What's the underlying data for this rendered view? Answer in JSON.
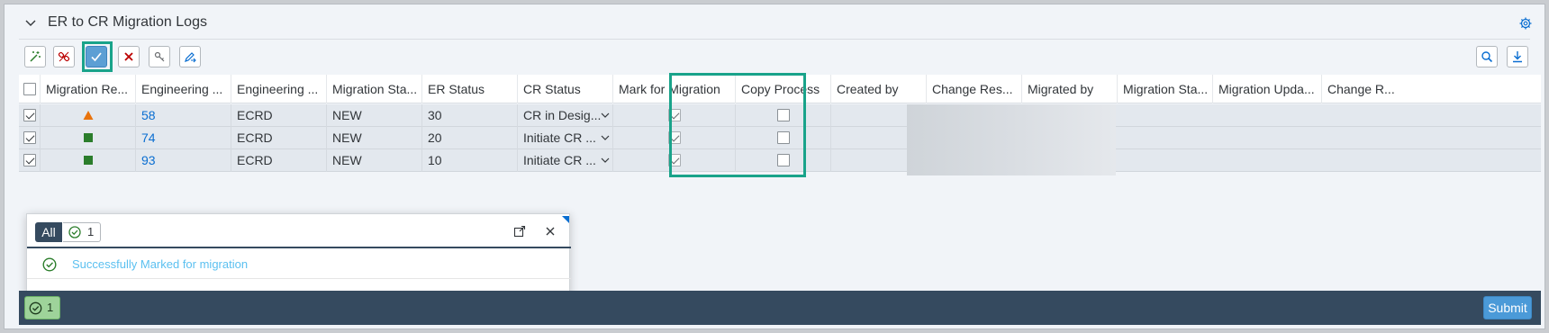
{
  "panel": {
    "title": "ER to CR Migration Logs"
  },
  "toolbar": {
    "buttons": [
      {
        "name": "magic-wand-icon",
        "color": "#2b7d2b"
      },
      {
        "name": "unlink-icon",
        "color": "#bb0000"
      },
      {
        "name": "checkmark-icon",
        "color": "#ffffff"
      },
      {
        "name": "cross-icon",
        "color": "#bb0000"
      },
      {
        "name": "key-user-icon",
        "color": "#6a6d70"
      },
      {
        "name": "edit-arrow-icon",
        "color": "#0a6ed1"
      }
    ],
    "right_buttons": [
      "search-icon",
      "download-icon"
    ]
  },
  "table": {
    "columns": [
      "Migration Re...",
      "Engineering ...",
      "Engineering ...",
      "Migration Sta...",
      "ER Status",
      "CR Status",
      "Mark for Migration",
      "Copy Process",
      "Created by",
      "Change Res...",
      "Migrated by",
      "Migration Sta...",
      "Migration Upda...",
      "Change R..."
    ],
    "rows": [
      {
        "indicator": "warning-triangle",
        "eng_no": "58",
        "eng_type": "ECRD",
        "mig_status": "NEW",
        "er_status": "30",
        "cr_status": "CR in Desig...",
        "mark": true,
        "copy": false
      },
      {
        "indicator": "success-square",
        "eng_no": "74",
        "eng_type": "ECRD",
        "mig_status": "NEW",
        "er_status": "20",
        "cr_status": "Initiate CR ...",
        "mark": true,
        "copy": false
      },
      {
        "indicator": "success-square",
        "eng_no": "93",
        "eng_type": "ECRD",
        "mig_status": "NEW",
        "er_status": "10",
        "cr_status": "Initiate CR ...",
        "mark": true,
        "copy": false
      }
    ]
  },
  "popover": {
    "filter_all": "All",
    "filter_success_count": "1",
    "messages": [
      {
        "type": "success",
        "text": "Successfully Marked for migration"
      }
    ]
  },
  "footer": {
    "message_count": "1",
    "submit_label": "Submit"
  },
  "colors": {
    "accent": "#0a6ed1",
    "success": "#2b7d2b",
    "warning": "#e9730c",
    "shell": "#354a5f",
    "highlight": "#19a38a"
  }
}
